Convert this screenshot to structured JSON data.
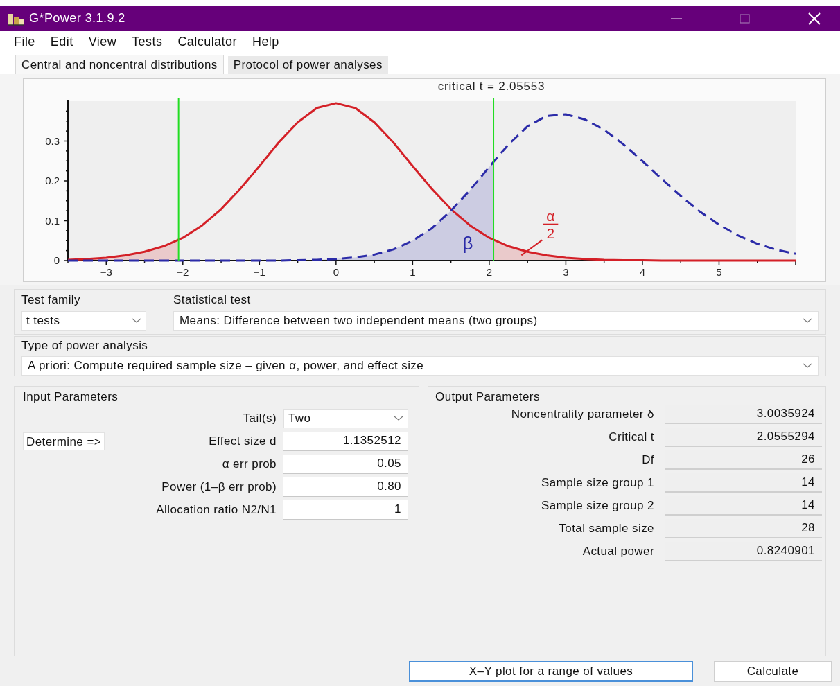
{
  "window": {
    "title": "G*Power 3.1.9.2"
  },
  "menu": [
    "File",
    "Edit",
    "View",
    "Tests",
    "Calculator",
    "Help"
  ],
  "tabs": [
    {
      "label": "Central and noncentral distributions",
      "selected": true
    },
    {
      "label": "Protocol of power analyses",
      "selected": false
    }
  ],
  "chart_data": {
    "type": "line",
    "title": "critical t = 2.05553",
    "xlim": [
      -3.5,
      6
    ],
    "ylim": [
      0,
      0.4
    ],
    "xticks": [
      {
        "value": -3,
        "label": "−3"
      },
      {
        "value": -2,
        "label": "−2"
      },
      {
        "value": -1,
        "label": "−1"
      },
      0,
      1,
      2,
      3,
      4,
      5
    ],
    "yticks": [
      0,
      0.1,
      0.2,
      0.3
    ],
    "x": [
      -3.5,
      -3.25,
      -3,
      -2.75,
      -2.5,
      -2.25,
      -2,
      -1.75,
      -1.5,
      -1.25,
      -1,
      -0.75,
      -0.5,
      -0.25,
      0,
      0.25,
      0.5,
      0.75,
      1,
      1.25,
      1.5,
      1.75,
      2,
      2.25,
      2.5,
      2.75,
      3,
      3.25,
      3.5,
      3.75,
      4,
      4.25,
      4.5,
      4.75,
      5,
      5.25,
      5.5,
      5.75,
      6
    ],
    "series": [
      {
        "color": "#d42027",
        "line_style": "solid",
        "values": [
          0.002,
          0.004,
          0.007,
          0.013,
          0.022,
          0.036,
          0.057,
          0.088,
          0.129,
          0.18,
          0.237,
          0.296,
          0.347,
          0.383,
          0.395,
          0.383,
          0.347,
          0.296,
          0.237,
          0.18,
          0.129,
          0.088,
          0.057,
          0.036,
          0.022,
          0.013,
          0.007,
          0.004,
          0.002,
          0.001,
          0.001,
          0,
          0,
          0,
          0,
          0,
          0,
          0,
          0
        ]
      },
      {
        "color": "#2b2ba8",
        "line_style": "dashed",
        "values": [
          0,
          0,
          0,
          0,
          0,
          0,
          0,
          0,
          0,
          0,
          0,
          0,
          0.001,
          0.002,
          0.004,
          0.008,
          0.015,
          0.028,
          0.05,
          0.081,
          0.125,
          0.177,
          0.235,
          0.291,
          0.337,
          0.363,
          0.367,
          0.354,
          0.328,
          0.292,
          0.25,
          0.205,
          0.162,
          0.123,
          0.09,
          0.063,
          0.042,
          0.027,
          0.017
        ]
      }
    ],
    "ref_lines": [
      {
        "axis": "x",
        "value": -2.05553,
        "color": "#22dd22"
      },
      {
        "axis": "x",
        "value": 2.05553,
        "color": "#22dd22"
      }
    ],
    "annotations": [
      "β",
      "α",
      "2"
    ]
  },
  "test_family": {
    "label": "Test family",
    "value": "t tests"
  },
  "statistical_test": {
    "label": "Statistical test",
    "value": "Means: Difference between two independent means (two groups)"
  },
  "power_analysis_type": {
    "label": "Type of power analysis",
    "value": "A priori: Compute required sample size – given α, power, and effect size"
  },
  "input_parameters": {
    "title": "Input Parameters",
    "determine_button": "Determine =>",
    "fields": [
      {
        "kind": "dropdown",
        "label": "Tail(s)",
        "value": "Two"
      },
      {
        "kind": "number",
        "label": "Effect size d",
        "value": "1.1352512"
      },
      {
        "kind": "number",
        "label": "α err prob",
        "value": "0.05"
      },
      {
        "kind": "number",
        "label": "Power (1–β err prob)",
        "value": "0.80"
      },
      {
        "kind": "number",
        "label": "Allocation ratio N2/N1",
        "value": "1"
      }
    ]
  },
  "output_parameters": {
    "title": "Output Parameters",
    "fields": [
      {
        "label": "Noncentrality parameter δ",
        "value": "3.0035924"
      },
      {
        "label": "Critical t",
        "value": "2.0555294"
      },
      {
        "label": "Df",
        "value": "26"
      },
      {
        "label": "Sample size group 1",
        "value": "14"
      },
      {
        "label": "Sample size group 2",
        "value": "14"
      },
      {
        "label": "Total sample size",
        "value": "28"
      },
      {
        "label": "Actual power",
        "value": "0.8240901"
      }
    ]
  },
  "buttons": [
    {
      "label": "X–Y plot for a range of values",
      "focused": true
    },
    {
      "label": "Calculate",
      "focused": false
    }
  ]
}
